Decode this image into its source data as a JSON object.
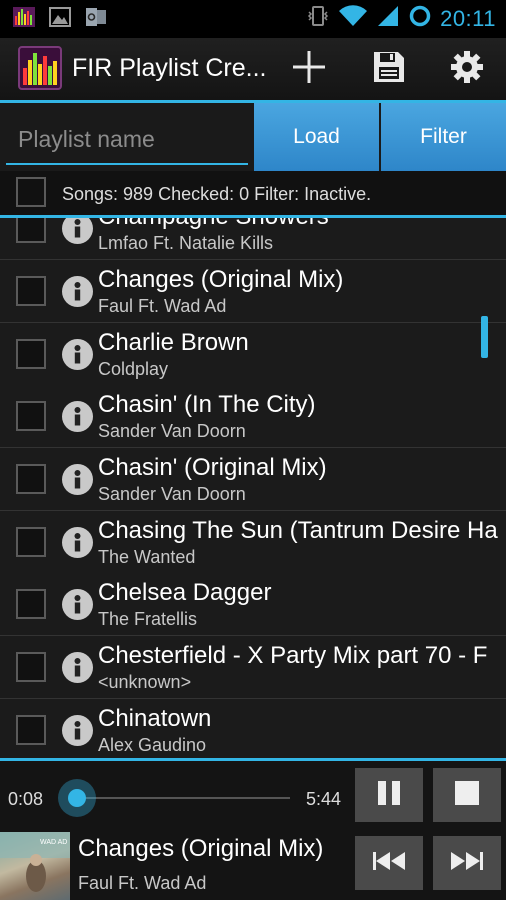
{
  "status_bar": {
    "time": "20:11",
    "left_icons": [
      "app-equalizer-icon",
      "image-icon",
      "outlook-icon"
    ],
    "right_icons": [
      "vibrate-icon",
      "wifi-icon",
      "signal-icon",
      "sync-ring-icon"
    ]
  },
  "action_bar": {
    "title": "FIR Playlist Cre...",
    "actions": [
      "add-icon",
      "save-icon",
      "settings-icon"
    ]
  },
  "playlist": {
    "name_placeholder": "Playlist name",
    "load_label": "Load",
    "filter_label": "Filter"
  },
  "info": {
    "summary": "Songs: 989  Checked: 0  Filter: Inactive."
  },
  "songs": [
    {
      "title": "Champagne Showers",
      "artist": "Lmfao Ft. Natalie Kills"
    },
    {
      "title": "Changes (Original Mix)",
      "artist": "Faul Ft. Wad Ad"
    },
    {
      "title": "Charlie Brown",
      "artist": "Coldplay"
    },
    {
      "title": "Chasin' (In The City)",
      "artist": "Sander Van Doorn"
    },
    {
      "title": "Chasin' (Original Mix)",
      "artist": "Sander Van Doorn"
    },
    {
      "title": "Chasing The Sun (Tantrum Desire Ha",
      "artist": "The Wanted"
    },
    {
      "title": "Chelsea Dagger",
      "artist": "The Fratellis"
    },
    {
      "title": "Chesterfield - X Party Mix part 70 - F",
      "artist": "<unknown>"
    },
    {
      "title": "Chinatown",
      "artist": "Alex Gaudino"
    }
  ],
  "player": {
    "elapsed": "0:08",
    "duration": "5:44",
    "progress": 0.023,
    "now_title": "Changes (Original Mix)",
    "now_artist": "Faul Ft. Wad Ad"
  },
  "colors": {
    "accent": "#33b5e5",
    "button_blue": "#3a96d6"
  }
}
